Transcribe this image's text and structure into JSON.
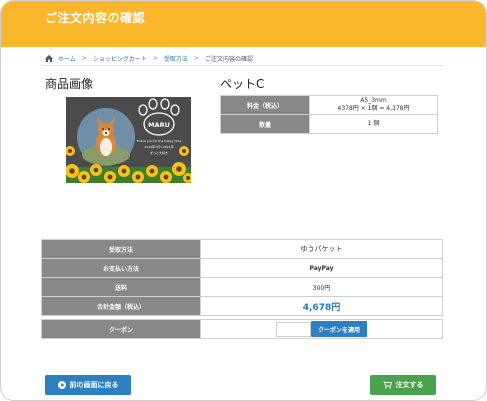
{
  "header": {
    "title": "ご注文内容の確認",
    "bg_color": "#fbb72c"
  },
  "breadcrumb": {
    "home_icon": "home-icon",
    "items": [
      "ホーム",
      "ショッピングカート",
      "受取方法",
      "ご注文内容の確認"
    ],
    "separator": ">"
  },
  "product": {
    "image_label": "商品画像",
    "name": "ペットC",
    "image": {
      "pet_name": "MARU",
      "caption": "Thank you for the happy time",
      "date_line": "2019年7月～2021年",
      "message": "ずっと大好き"
    }
  },
  "price_table": [
    {
      "label": "料金（税込）",
      "value_line1": "A5_3mm",
      "value_line2": "4378円 × 1個 = 4,378円"
    },
    {
      "label": "数量",
      "value_line1": "1 個",
      "value_line2": ""
    }
  ],
  "delivery": {
    "method_label": "受取方法",
    "method_value": "ゆうパケット",
    "payment_label": "お支払い方法",
    "payment_value": "PayPay"
  },
  "totals": {
    "shipping_label": "送料",
    "shipping_value": "300円",
    "total_label": "合計金額（税込）",
    "total_value": "4,678円"
  },
  "coupon": {
    "label": "クーポン",
    "input_value": "",
    "apply_label": "クーポンを適用"
  },
  "buttons": {
    "back_label": "前の画面に戻る",
    "back_icon": "arrow-left-circle-icon",
    "order_label": "注文する",
    "order_icon": "cart-icon"
  },
  "colors": {
    "accent_blue": "#2e7fbf",
    "order_green": "#4aa24f",
    "header_th": "#888888"
  }
}
